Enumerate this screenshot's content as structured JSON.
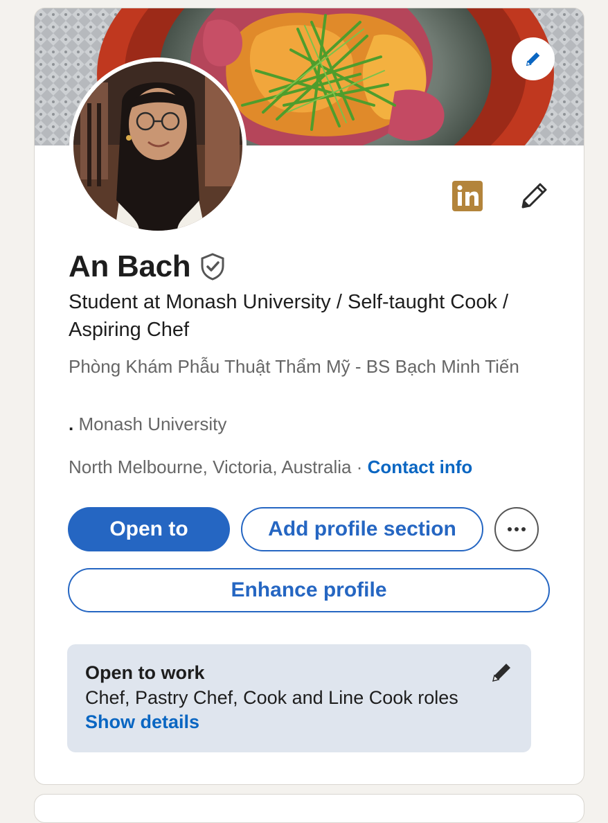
{
  "profile": {
    "name": "An Bach",
    "headline": "Student at Monash University / Self-taught Cook / Aspiring Chef",
    "company": "Phòng Khám Phẫu Thuật Thẩm Mỹ - BS Bạch Minh Tiến",
    "school_bullet": ".",
    "school": "Monash University",
    "location": "North Melbourne, Victoria, Australia",
    "location_separator": "·",
    "contact_info_label": "Contact info"
  },
  "actions": {
    "open_to_label": "Open to",
    "add_section_label": "Add profile section",
    "enhance_label": "Enhance profile"
  },
  "open_to_work": {
    "title": "Open to work",
    "roles": "Chef, Pastry Chef, Cook and Line Cook roles",
    "details_label": "Show details"
  },
  "icons": {
    "banner_edit": "pencil-icon",
    "linkedin_badge": "linkedin-icon",
    "profile_edit": "pencil-icon",
    "verified": "verified-shield-icon",
    "more": "ellipsis-icon",
    "open_to_work_edit": "pencil-icon"
  },
  "colors": {
    "primary": "#2566c2",
    "link": "#0a66c2",
    "linkedin_badge_bg": "#b3843b",
    "open_to_work_bg": "#dfe5ee",
    "page_bg": "#f4f2ee"
  }
}
